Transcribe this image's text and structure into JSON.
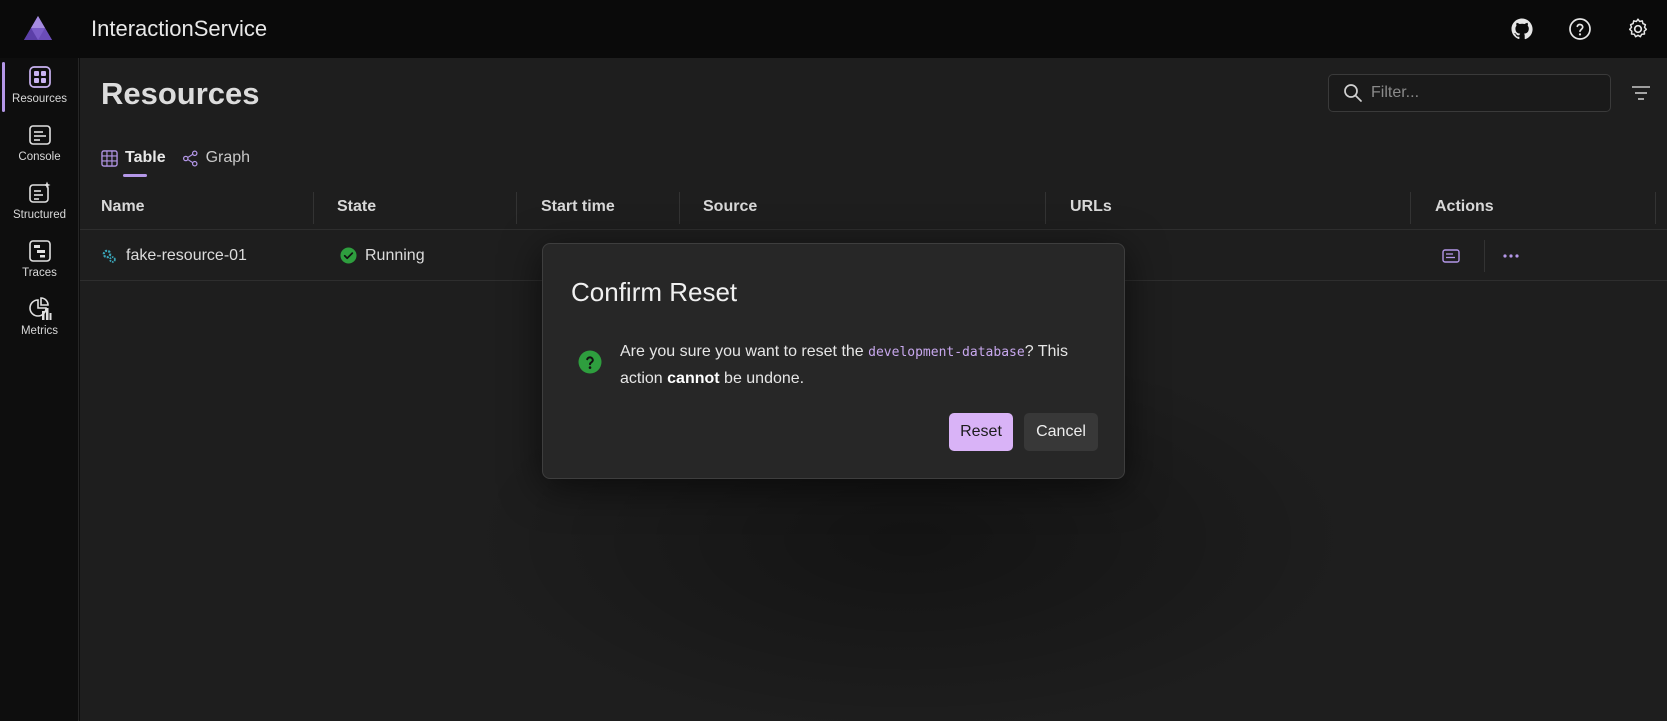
{
  "header": {
    "app_title": "InteractionService",
    "icons": [
      "github-icon",
      "help-icon",
      "settings-icon"
    ]
  },
  "sidebar": {
    "items": [
      {
        "label": "Resources",
        "icon": "resources-icon",
        "active": true
      },
      {
        "label": "Console",
        "icon": "console-icon",
        "active": false
      },
      {
        "label": "Structured",
        "icon": "structured-icon",
        "active": false
      },
      {
        "label": "Traces",
        "icon": "traces-icon",
        "active": false
      },
      {
        "label": "Metrics",
        "icon": "metrics-icon",
        "active": false
      }
    ]
  },
  "main": {
    "page_title": "Resources",
    "filter_placeholder": "Filter...",
    "tabs": [
      {
        "label": "Table",
        "active": true
      },
      {
        "label": "Graph",
        "active": false
      }
    ],
    "columns": [
      "Name",
      "State",
      "Start time",
      "Source",
      "URLs",
      "Actions"
    ],
    "rows": [
      {
        "name": "fake-resource-01",
        "state": "Running",
        "start_time": "",
        "source": "",
        "urls": ""
      }
    ]
  },
  "dialog": {
    "title": "Confirm Reset",
    "message_prefix": "Are you sure you want to reset the ",
    "message_code": "development-database",
    "message_middle": "? This action ",
    "message_bold": "cannot",
    "message_suffix": " be undone.",
    "reset_label": "Reset",
    "cancel_label": "Cancel"
  },
  "colors": {
    "accent": "#b497e8",
    "primary_button": "#d9b3f7",
    "success": "#2e9e3e",
    "background": "#1e1e1e"
  }
}
